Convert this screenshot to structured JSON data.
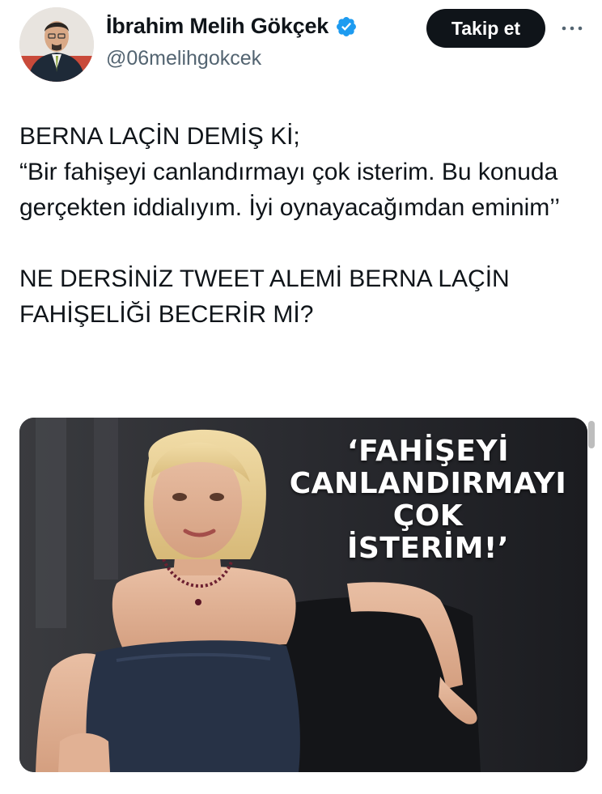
{
  "author": {
    "display_name": "İbrahim Melih Gökçek",
    "handle": "@06melihgokcek",
    "verified": true,
    "verified_color": "#1d9bf0",
    "avatar_icon": "profile-photo"
  },
  "header": {
    "follow_label": "Takip et",
    "more_icon": "more-dots-icon"
  },
  "tweet": {
    "lines": [
      "BERNA LAÇİN DEMİŞ Kİ;",
      "“Bir fahişeyi canlandırmayı çok isterim. Bu konuda gerçekten iddialıyım. İyi oynayacağımdan eminim’’",
      "NE DERSİNİZ TWEET ALEMİ  BERNA LAÇİN FAHİŞELİĞİ BECERİR Mİ?"
    ]
  },
  "media": {
    "overlay_lines": [
      "‘FAHİŞEYİ",
      "CANLANDIRMAYI",
      "ÇOK",
      "İSTERİM!’"
    ]
  },
  "colors": {
    "text_primary": "#0f1419",
    "text_secondary": "#536471",
    "button_bg": "#0f1419",
    "button_text": "#ffffff"
  }
}
